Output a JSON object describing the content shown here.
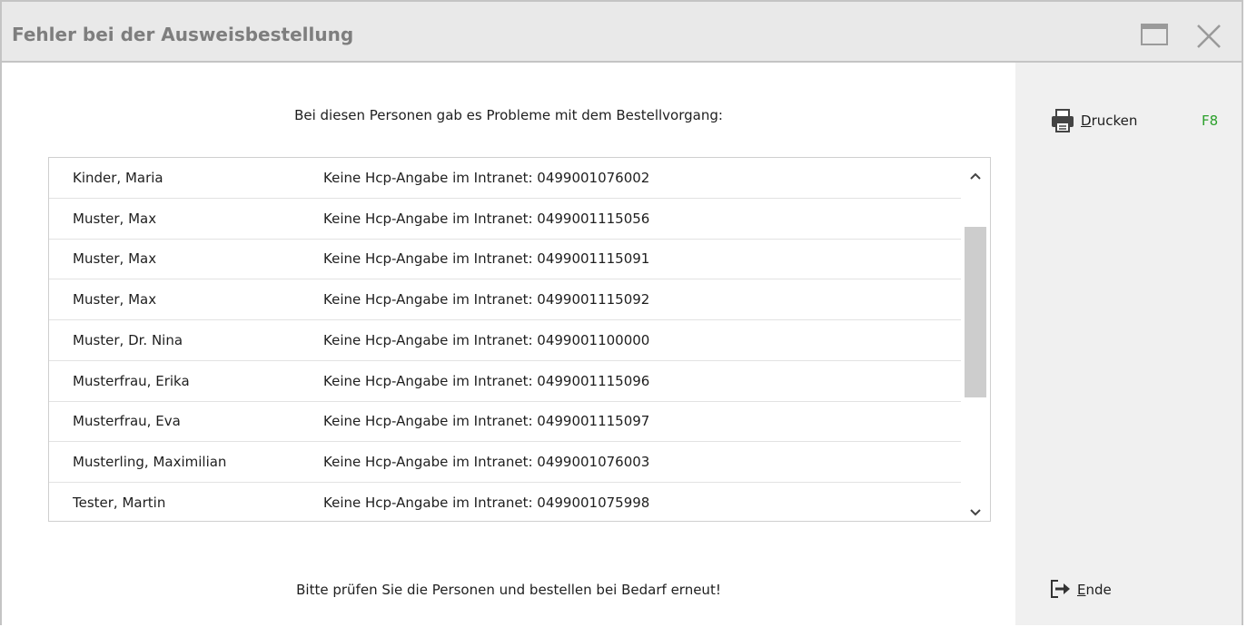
{
  "window": {
    "title": "Fehler bei der Ausweisbestellung"
  },
  "main": {
    "header": "Bei diesen Personen gab es Probleme mit dem Bestellvorgang:",
    "footer": "Bitte prüfen Sie die Personen und bestellen bei Bedarf erneut!",
    "rows": [
      {
        "name": "Kinder, Maria",
        "message": "Keine Hcp-Angabe im Intranet: 0499001076002"
      },
      {
        "name": "Muster, Max",
        "message": "Keine Hcp-Angabe im Intranet: 0499001115056"
      },
      {
        "name": "Muster, Max",
        "message": "Keine Hcp-Angabe im Intranet: 0499001115091"
      },
      {
        "name": "Muster, Max",
        "message": "Keine Hcp-Angabe im Intranet: 0499001115092"
      },
      {
        "name": "Muster, Dr. Nina",
        "message": "Keine Hcp-Angabe im Intranet: 0499001100000"
      },
      {
        "name": "Musterfrau, Erika",
        "message": "Keine Hcp-Angabe im Intranet: 0499001115096"
      },
      {
        "name": "Musterfrau, Eva",
        "message": "Keine Hcp-Angabe im Intranet: 0499001115097"
      },
      {
        "name": "Musterling, Maximilian",
        "message": "Keine Hcp-Angabe im Intranet: 0499001076003"
      },
      {
        "name": "Tester, Martin",
        "message": "Keine Hcp-Angabe im Intranet: 0499001075998"
      }
    ]
  },
  "side": {
    "print": {
      "label_mnemonic": "D",
      "label_rest": "rucken",
      "shortcut": "F8",
      "icon": "printer-icon"
    },
    "end": {
      "label_mnemonic": "E",
      "label_rest": "nde",
      "icon": "exit-icon"
    }
  },
  "colors": {
    "titlebar_bg": "#e9e9e9",
    "title_text": "#7e7e7e",
    "side_bg": "#f0f0f0",
    "shortcut": "#2aa02a",
    "scroll_thumb": "#cdcdcd"
  }
}
